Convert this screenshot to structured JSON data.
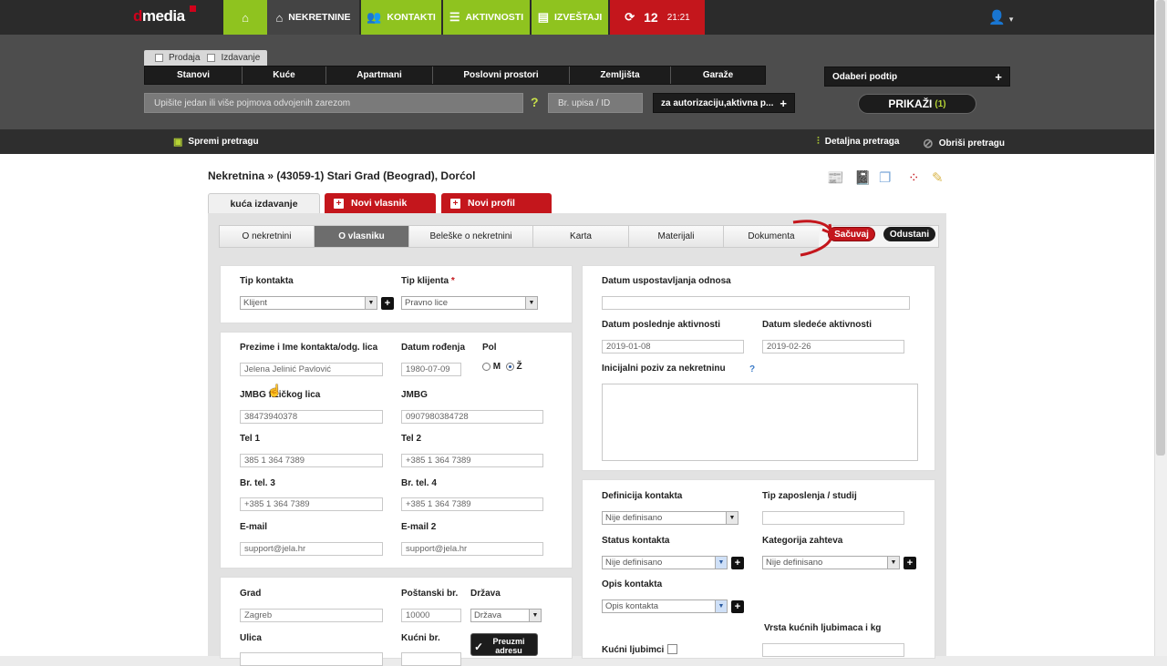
{
  "topnav": {
    "logo_d": "d",
    "logo_rest": "media",
    "home_icon": "home-icon",
    "items": [
      {
        "label": "NEKRETNINE",
        "icon": "house-icon"
      },
      {
        "label": "KONTAKTI",
        "icon": "users-icon"
      },
      {
        "label": "AKTIVNOSTI",
        "icon": "list-icon"
      },
      {
        "label": "IZVEŠTAJI",
        "icon": "document-icon"
      }
    ],
    "sync_count": "12",
    "clock": "21:21",
    "user_icon": "user-icon"
  },
  "search": {
    "types": [
      "Prodaja",
      "Izdavanje"
    ],
    "categories": [
      "Stanovi",
      "Kuće",
      "Apartmani",
      "Poslovni prostori",
      "Zemljišta",
      "Garaže"
    ],
    "keywords_placeholder": "Upišite jedan ili više pojmova odvojenih zarezom",
    "help": "?",
    "id_placeholder": "Br. upisa / ID",
    "status_filter": "za autorizaciju,aktivna p...",
    "subtype": "Odaberi podtip",
    "show_label": "PRIKAŽI",
    "show_count": "(1)"
  },
  "toolbar": {
    "save_search": "Spremi pretragu",
    "advanced": "Detaljna pretraga",
    "clear": "Obriši pretragu"
  },
  "breadcrumb": {
    "root": "Nekretnina",
    "current": "» (43059-1) Stari Grad (Beograd), Dorćol"
  },
  "doc_tabs": {
    "active": "kuća izdavanje",
    "new_owner": "Novi vlasnik",
    "new_profile": "Novi profil"
  },
  "section_tabs": [
    "O nekretnini",
    "O vlasniku",
    "Beleške o nekretnini",
    "Karta",
    "Materijali",
    "Dokumenta"
  ],
  "buttons": {
    "save": "Sačuvaj",
    "cancel": "Odustani"
  },
  "form": {
    "contact_type_label": "Tip kontakta",
    "contact_type_value": "Klijent",
    "client_type_label": "Tip klijenta",
    "client_type_required": "*",
    "client_type_value": "Pravno lice",
    "name_label": "Prezime i Ime kontakta/odg. lica",
    "name_value": "Jelena Jelinić Pavlović",
    "dob_label": "Datum rođenja",
    "dob_value": "1980-07-09",
    "sex_label": "Pol",
    "sex_m": "M",
    "sex_z": "Ž",
    "jmbg_person_label": "JMBG fizičkog lica",
    "jmbg_person_value": "38473940378",
    "jmbg_label": "JMBG",
    "jmbg_value": "0907980384728",
    "tel1_label": "Tel 1",
    "tel1_value": "385 1 364 7389",
    "tel2_label": "Tel 2",
    "tel2_value": "+385 1 364 7389",
    "tel3_label": "Br. tel. 3",
    "tel3_value": "+385 1 364 7389",
    "tel4_label": "Br. tel. 4",
    "tel4_value": "+385 1 364 7389",
    "email_label": "E-mail",
    "email_value": "support@jela.hr",
    "email2_label": "E-mail 2",
    "email2_value": "support@jela.hr",
    "city_label": "Grad",
    "city_value": "Zagreb",
    "zip_label": "Poštanski br.",
    "zip_value": "10000",
    "country_label": "Država",
    "country_value": "Država",
    "street_label": "Ulica",
    "house_no_label": "Kućni br.",
    "fetch_address": "Preuzmi adresu",
    "rel_date_label": "Datum uspostavljanja odnosa",
    "last_activity_label": "Datum poslednje aktivnosti",
    "last_activity_value": "2019-01-08",
    "next_activity_label": "Datum sledeće aktivnosti",
    "next_activity_value": "2019-02-26",
    "initial_call_label": "Inicijalni poziv za nekretninu",
    "help": "?",
    "contact_def_label": "Definicija kontakta",
    "contact_def_value": "Nije definisano",
    "employment_label": "Tip zaposlenja / studij",
    "status_label": "Status kontakta",
    "status_value": "Nije definisano",
    "req_category_label": "Kategorija zahteva",
    "req_category_value": "Nije definisano",
    "contact_desc_label": "Opis kontakta",
    "contact_desc_value": "Opis kontakta",
    "pets_type_label": "Vrsta kućnih ljubimaca i kg",
    "pets_label": "Kućni ljubimci"
  },
  "colors": {
    "brand_red": "#c4161c",
    "accent_green": "#8fc31f",
    "dark": "#2b2b2b"
  }
}
